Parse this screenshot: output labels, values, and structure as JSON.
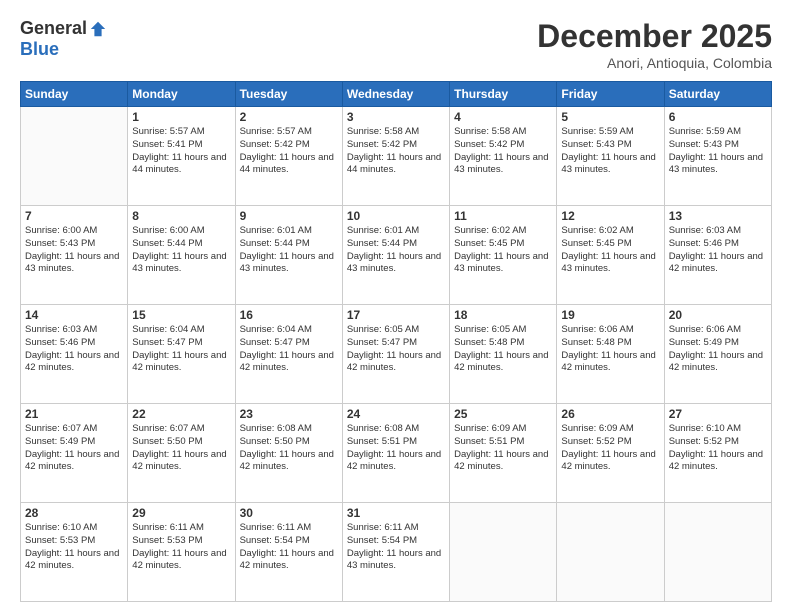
{
  "header": {
    "logo_general": "General",
    "logo_blue": "Blue",
    "title": "December 2025",
    "location": "Anori, Antioquia, Colombia"
  },
  "weekdays": [
    "Sunday",
    "Monday",
    "Tuesday",
    "Wednesday",
    "Thursday",
    "Friday",
    "Saturday"
  ],
  "weeks": [
    [
      {
        "day": "",
        "sunrise": "",
        "sunset": "",
        "daylight": ""
      },
      {
        "day": "1",
        "sunrise": "Sunrise: 5:57 AM",
        "sunset": "Sunset: 5:41 PM",
        "daylight": "Daylight: 11 hours and 44 minutes."
      },
      {
        "day": "2",
        "sunrise": "Sunrise: 5:57 AM",
        "sunset": "Sunset: 5:42 PM",
        "daylight": "Daylight: 11 hours and 44 minutes."
      },
      {
        "day": "3",
        "sunrise": "Sunrise: 5:58 AM",
        "sunset": "Sunset: 5:42 PM",
        "daylight": "Daylight: 11 hours and 44 minutes."
      },
      {
        "day": "4",
        "sunrise": "Sunrise: 5:58 AM",
        "sunset": "Sunset: 5:42 PM",
        "daylight": "Daylight: 11 hours and 43 minutes."
      },
      {
        "day": "5",
        "sunrise": "Sunrise: 5:59 AM",
        "sunset": "Sunset: 5:43 PM",
        "daylight": "Daylight: 11 hours and 43 minutes."
      },
      {
        "day": "6",
        "sunrise": "Sunrise: 5:59 AM",
        "sunset": "Sunset: 5:43 PM",
        "daylight": "Daylight: 11 hours and 43 minutes."
      }
    ],
    [
      {
        "day": "7",
        "sunrise": "Sunrise: 6:00 AM",
        "sunset": "Sunset: 5:43 PM",
        "daylight": "Daylight: 11 hours and 43 minutes."
      },
      {
        "day": "8",
        "sunrise": "Sunrise: 6:00 AM",
        "sunset": "Sunset: 5:44 PM",
        "daylight": "Daylight: 11 hours and 43 minutes."
      },
      {
        "day": "9",
        "sunrise": "Sunrise: 6:01 AM",
        "sunset": "Sunset: 5:44 PM",
        "daylight": "Daylight: 11 hours and 43 minutes."
      },
      {
        "day": "10",
        "sunrise": "Sunrise: 6:01 AM",
        "sunset": "Sunset: 5:44 PM",
        "daylight": "Daylight: 11 hours and 43 minutes."
      },
      {
        "day": "11",
        "sunrise": "Sunrise: 6:02 AM",
        "sunset": "Sunset: 5:45 PM",
        "daylight": "Daylight: 11 hours and 43 minutes."
      },
      {
        "day": "12",
        "sunrise": "Sunrise: 6:02 AM",
        "sunset": "Sunset: 5:45 PM",
        "daylight": "Daylight: 11 hours and 43 minutes."
      },
      {
        "day": "13",
        "sunrise": "Sunrise: 6:03 AM",
        "sunset": "Sunset: 5:46 PM",
        "daylight": "Daylight: 11 hours and 42 minutes."
      }
    ],
    [
      {
        "day": "14",
        "sunrise": "Sunrise: 6:03 AM",
        "sunset": "Sunset: 5:46 PM",
        "daylight": "Daylight: 11 hours and 42 minutes."
      },
      {
        "day": "15",
        "sunrise": "Sunrise: 6:04 AM",
        "sunset": "Sunset: 5:47 PM",
        "daylight": "Daylight: 11 hours and 42 minutes."
      },
      {
        "day": "16",
        "sunrise": "Sunrise: 6:04 AM",
        "sunset": "Sunset: 5:47 PM",
        "daylight": "Daylight: 11 hours and 42 minutes."
      },
      {
        "day": "17",
        "sunrise": "Sunrise: 6:05 AM",
        "sunset": "Sunset: 5:47 PM",
        "daylight": "Daylight: 11 hours and 42 minutes."
      },
      {
        "day": "18",
        "sunrise": "Sunrise: 6:05 AM",
        "sunset": "Sunset: 5:48 PM",
        "daylight": "Daylight: 11 hours and 42 minutes."
      },
      {
        "day": "19",
        "sunrise": "Sunrise: 6:06 AM",
        "sunset": "Sunset: 5:48 PM",
        "daylight": "Daylight: 11 hours and 42 minutes."
      },
      {
        "day": "20",
        "sunrise": "Sunrise: 6:06 AM",
        "sunset": "Sunset: 5:49 PM",
        "daylight": "Daylight: 11 hours and 42 minutes."
      }
    ],
    [
      {
        "day": "21",
        "sunrise": "Sunrise: 6:07 AM",
        "sunset": "Sunset: 5:49 PM",
        "daylight": "Daylight: 11 hours and 42 minutes."
      },
      {
        "day": "22",
        "sunrise": "Sunrise: 6:07 AM",
        "sunset": "Sunset: 5:50 PM",
        "daylight": "Daylight: 11 hours and 42 minutes."
      },
      {
        "day": "23",
        "sunrise": "Sunrise: 6:08 AM",
        "sunset": "Sunset: 5:50 PM",
        "daylight": "Daylight: 11 hours and 42 minutes."
      },
      {
        "day": "24",
        "sunrise": "Sunrise: 6:08 AM",
        "sunset": "Sunset: 5:51 PM",
        "daylight": "Daylight: 11 hours and 42 minutes."
      },
      {
        "day": "25",
        "sunrise": "Sunrise: 6:09 AM",
        "sunset": "Sunset: 5:51 PM",
        "daylight": "Daylight: 11 hours and 42 minutes."
      },
      {
        "day": "26",
        "sunrise": "Sunrise: 6:09 AM",
        "sunset": "Sunset: 5:52 PM",
        "daylight": "Daylight: 11 hours and 42 minutes."
      },
      {
        "day": "27",
        "sunrise": "Sunrise: 6:10 AM",
        "sunset": "Sunset: 5:52 PM",
        "daylight": "Daylight: 11 hours and 42 minutes."
      }
    ],
    [
      {
        "day": "28",
        "sunrise": "Sunrise: 6:10 AM",
        "sunset": "Sunset: 5:53 PM",
        "daylight": "Daylight: 11 hours and 42 minutes."
      },
      {
        "day": "29",
        "sunrise": "Sunrise: 6:11 AM",
        "sunset": "Sunset: 5:53 PM",
        "daylight": "Daylight: 11 hours and 42 minutes."
      },
      {
        "day": "30",
        "sunrise": "Sunrise: 6:11 AM",
        "sunset": "Sunset: 5:54 PM",
        "daylight": "Daylight: 11 hours and 42 minutes."
      },
      {
        "day": "31",
        "sunrise": "Sunrise: 6:11 AM",
        "sunset": "Sunset: 5:54 PM",
        "daylight": "Daylight: 11 hours and 43 minutes."
      },
      {
        "day": "",
        "sunrise": "",
        "sunset": "",
        "daylight": ""
      },
      {
        "day": "",
        "sunrise": "",
        "sunset": "",
        "daylight": ""
      },
      {
        "day": "",
        "sunrise": "",
        "sunset": "",
        "daylight": ""
      }
    ]
  ]
}
